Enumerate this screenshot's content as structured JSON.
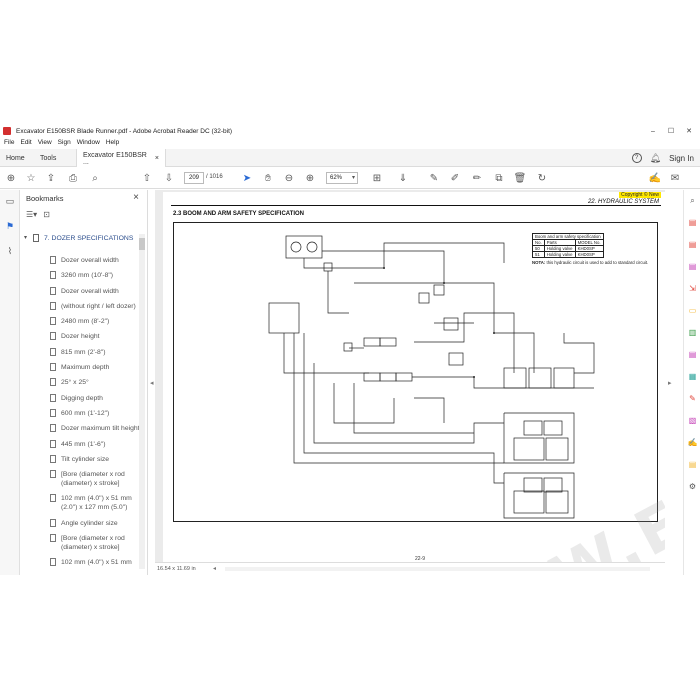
{
  "window": {
    "title": "Excavator E150BSR Blade Runner.pdf - Adobe Acrobat Reader DC (32-bit)",
    "controls": [
      "–",
      "☐",
      "✕"
    ]
  },
  "menu": [
    "File",
    "Edit",
    "View",
    "Sign",
    "Window",
    "Help"
  ],
  "tabs": {
    "home": "Home",
    "tools": "Tools",
    "document": "Excavator E150BSR ...",
    "close": "×",
    "signin": "Sign In",
    "help_icon": "?"
  },
  "toolbar": {
    "page_current": "209",
    "page_total": "/ 1016",
    "zoom": "62%",
    "zoom_dropdown": "▾"
  },
  "bookmarks": {
    "header": "Bookmarks",
    "close": "×",
    "parent": "7. DOZER SPECIFICATIONS",
    "items": [
      "Dozer overall width",
      "3260 mm (10'-8\")",
      "Dozer overall width",
      "(without right / left dozer)",
      "2480 mm (8'-2\")",
      "Dozer height",
      "815 mm (2'-8\")",
      "Maximum depth",
      "25° x 25°",
      "Digging depth",
      "600 mm (1'-12\")",
      "Dozer maximum tilt height",
      "445 mm (1'-6\")",
      "Tilt cylinder size",
      "[Bore (diameter x rod (diameter) x stroke]",
      "102 mm (4.0\") x 51 mm (2.0\") x 127 mm (5.0\")",
      "Angle cylinder size",
      "[Bore (diameter x rod (diameter) x stroke]",
      "102 mm (4.0\") x 51 mm"
    ]
  },
  "document": {
    "copyright": "Copyright © New",
    "chapter": "22. HYDRAULIC SYSTEM",
    "section": "2.3    BOOM AND ARM SAFETY SPECIFICATION",
    "table": {
      "title": "Boom and arm safety specification",
      "headers": [
        "No.",
        "Parts",
        "MODEL No."
      ],
      "rows": [
        [
          "50",
          "Holding valve",
          "KHD0SP"
        ],
        [
          "51",
          "Holding valve",
          "KHD0SP"
        ]
      ],
      "note_label": "NOTA:",
      "note_text": "this hydraulic circuit is used to add to standard circuit."
    },
    "page_number": "22-9",
    "watermark": "WWW.EPCBBO.COM"
  },
  "status": {
    "dims": "16.54 x 11.69 in",
    "arrow": "◂"
  },
  "colors": {
    "accent": "#d32f2f",
    "highlight": "#ffe800",
    "link": "#2b4d8c"
  }
}
